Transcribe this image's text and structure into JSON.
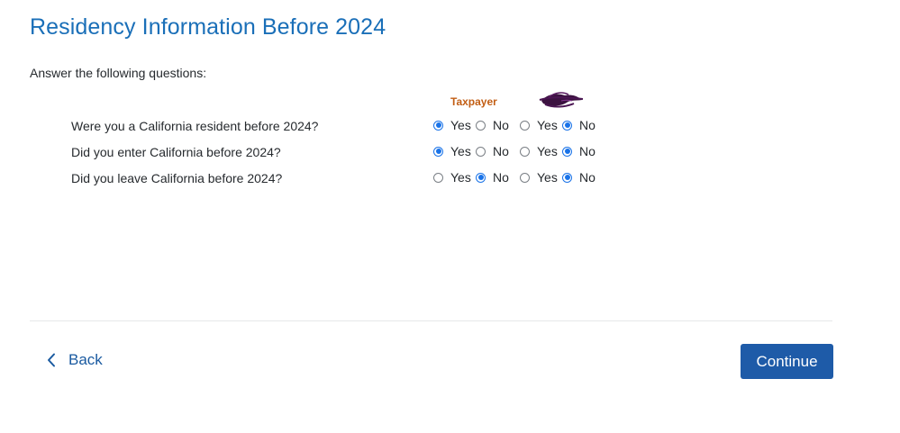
{
  "page": {
    "title": "Residency Information Before 2024",
    "instructions": "Answer the following questions:"
  },
  "columns": {
    "taxpayer": "Taxpayer"
  },
  "options": {
    "yes": "Yes",
    "no": "No"
  },
  "questions": [
    {
      "text": "Were you a California resident before 2024?",
      "taxpayer_answer": "Yes",
      "spouse_answer": "No"
    },
    {
      "text": "Did you enter California before 2024?",
      "taxpayer_answer": "Yes",
      "spouse_answer": "No"
    },
    {
      "text": "Did you leave California before 2024?",
      "taxpayer_answer": "No",
      "spouse_answer": "No"
    }
  ],
  "footer": {
    "back_label": "Back",
    "continue_label": "Continue"
  },
  "colors": {
    "title": "#1a6fb8",
    "taxpayer_header": "#c25e14",
    "primary_button": "#1e5ba8",
    "radio_checked": "#1a73e8"
  },
  "icons": {
    "back": "chevron-left-icon",
    "spouse_header": "redacted-name-scribble"
  }
}
